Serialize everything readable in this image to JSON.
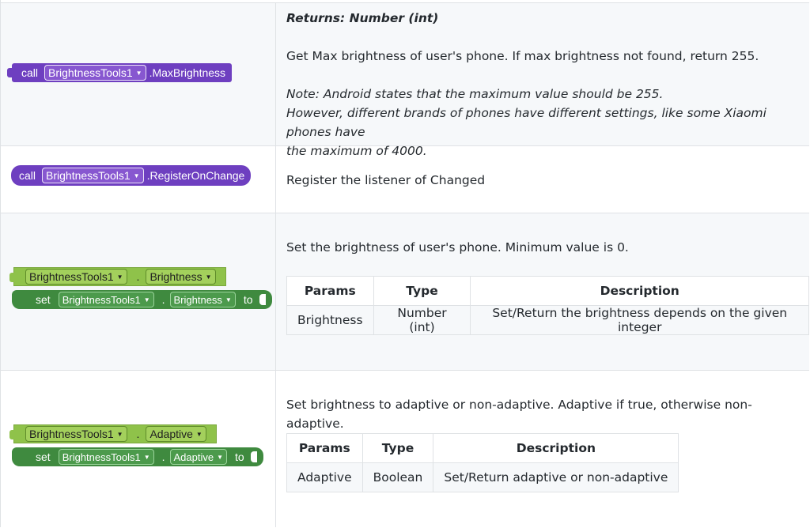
{
  "rows": [
    {
      "block": {
        "keyword": "call",
        "component": "BrightnessTools1",
        "method": ".MaxBrightness"
      },
      "returns": "Returns: Number (int)",
      "description": "Get Max brightness of user's phone. If max brightness not found, return 255.",
      "note_line1": "Note: Android states that the maximum value should be 255.",
      "note_line2": "However, different brands of phones have different settings, like some Xiaomi phones have",
      "note_line3": "the maximum of 4000."
    },
    {
      "block": {
        "keyword": "call",
        "component": "BrightnessTools1",
        "method": ".RegisterOnChange"
      },
      "description": "Register the listener of Changed"
    },
    {
      "getter": {
        "component": "BrightnessTools1",
        "property": "Brightness"
      },
      "setter": {
        "keyword": "set",
        "component": "BrightnessTools1",
        "property": "Brightness",
        "to": "to"
      },
      "description": "Set the brightness of user's phone. Minimum value is 0.",
      "table": {
        "headers": [
          "Params",
          "Type",
          "Description"
        ],
        "row": [
          "Brightness",
          "Number (int)",
          "Set/Return the brightness depends on the given integer"
        ]
      }
    },
    {
      "getter": {
        "component": "BrightnessTools1",
        "property": "Adaptive"
      },
      "setter": {
        "keyword": "set",
        "component": "BrightnessTools1",
        "property": "Adaptive",
        "to": "to"
      },
      "description": "Set brightness to adaptive or non-adaptive. Adaptive if true, otherwise non-adaptive.",
      "table": {
        "headers": [
          "Params",
          "Type",
          "Description"
        ],
        "row": [
          "Adaptive",
          "Boolean",
          "Set/Return adaptive or non-adaptive"
        ]
      }
    }
  ],
  "colors": {
    "call_block": "#6e3fc0",
    "getter_block": "#8fc24a",
    "setter_block": "#3f8a3f",
    "border": "#dfe2e5",
    "shade": "#f6f8fa"
  },
  "icons": {
    "dropdown": "triangle-down"
  }
}
